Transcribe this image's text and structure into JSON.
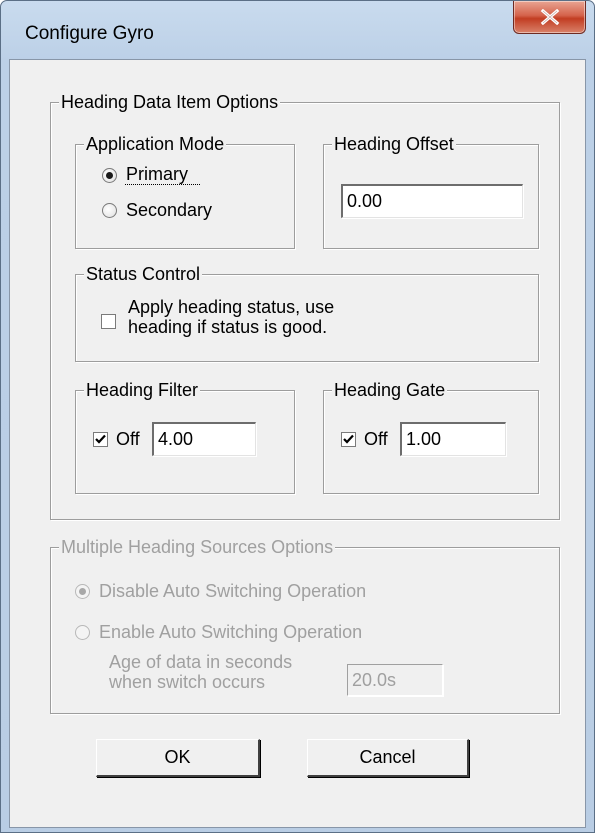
{
  "window": {
    "title": "Configure Gyro",
    "close_icon": "close-icon"
  },
  "heading_data": {
    "legend": "Heading Data Item Options",
    "application_mode": {
      "legend": "Application Mode",
      "options": [
        {
          "label": "Primary",
          "selected": true
        },
        {
          "label": "Secondary",
          "selected": false
        }
      ]
    },
    "heading_offset": {
      "legend": "Heading Offset",
      "value": "0.00"
    },
    "status_control": {
      "legend": "Status Control",
      "checkbox_label_line1": "Apply heading status, use",
      "checkbox_label_line2": "heading if status is good.",
      "checked": false
    },
    "heading_filter": {
      "legend": "Heading Filter",
      "off_label": "Off",
      "checked": true,
      "value": "4.00"
    },
    "heading_gate": {
      "legend": "Heading Gate",
      "off_label": "Off",
      "checked": true,
      "value": "1.00"
    }
  },
  "multiple_sources": {
    "legend": "Multiple Heading Sources Options",
    "enabled": false,
    "options": [
      {
        "label": "Disable Auto Switching Operation",
        "selected": true
      },
      {
        "label": "Enable Auto Switching Operation",
        "selected": false
      }
    ],
    "age_label_line1": "Age of data in seconds",
    "age_label_line2": "when switch occurs",
    "age_value": "20.0s"
  },
  "buttons": {
    "ok": "OK",
    "cancel": "Cancel"
  }
}
